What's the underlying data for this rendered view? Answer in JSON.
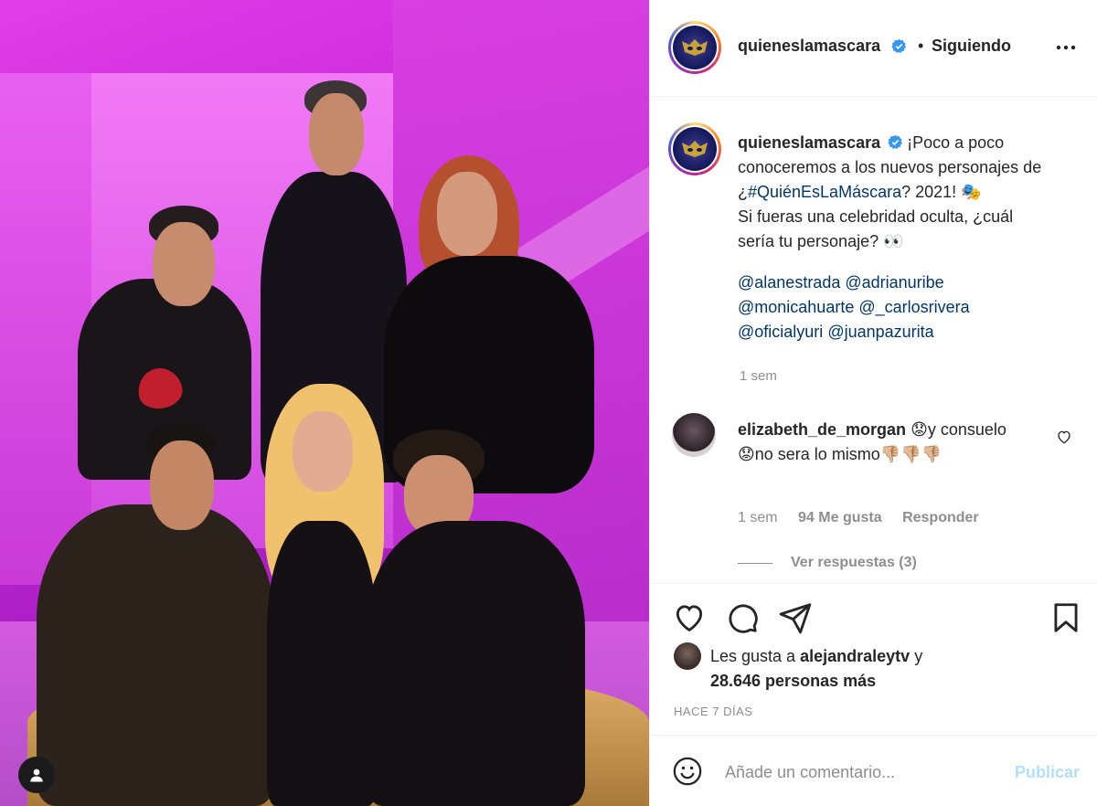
{
  "post": {
    "account": "quieneslamascara",
    "follow_status": "Siguiendo",
    "verified_icon": "verified-badge-icon",
    "more_icon": "more-options-icon"
  },
  "caption": {
    "username": "quieneslamascara",
    "text_before_hashtag": "¡Poco a poco conoceremos a los nuevos personajes de ¿",
    "hashtag": "#QuiénEsLaMáscara",
    "text_after_hashtag": "? 2021! 🎭",
    "text_line2": "Si fueras una celebridad oculta, ¿cuál sería tu personaje? 👀",
    "mentions": [
      "@alanestrada",
      "@adrianuribe",
      "@monicahuarte",
      "@_carlosrivera",
      "@oficialyuri",
      "@juanpazurita"
    ],
    "time": "1 sem"
  },
  "comment": {
    "username": "elizabeth_de_morgan",
    "text": "😟y consuelo 😟no sera lo mismo👎🏼👎🏼👎🏼",
    "time": "1 sem",
    "likes": "94 Me gusta",
    "reply": "Responder",
    "view_replies": "Ver respuestas (3)"
  },
  "actions": {
    "liked_by_prefix": "Les gusta a",
    "liked_by_user": "alejandraleytv",
    "liked_by_joiner": "y",
    "liked_by_others": "28.646 personas más",
    "date": "HACE 7 DÍAS"
  },
  "add_comment": {
    "placeholder": "Añade un comentario...",
    "publish": "Publicar"
  },
  "colors": {
    "link": "#00376b",
    "verified": "#3897f0",
    "publish_disabled": "#b2dffc",
    "muted": "#8e8e8e"
  }
}
